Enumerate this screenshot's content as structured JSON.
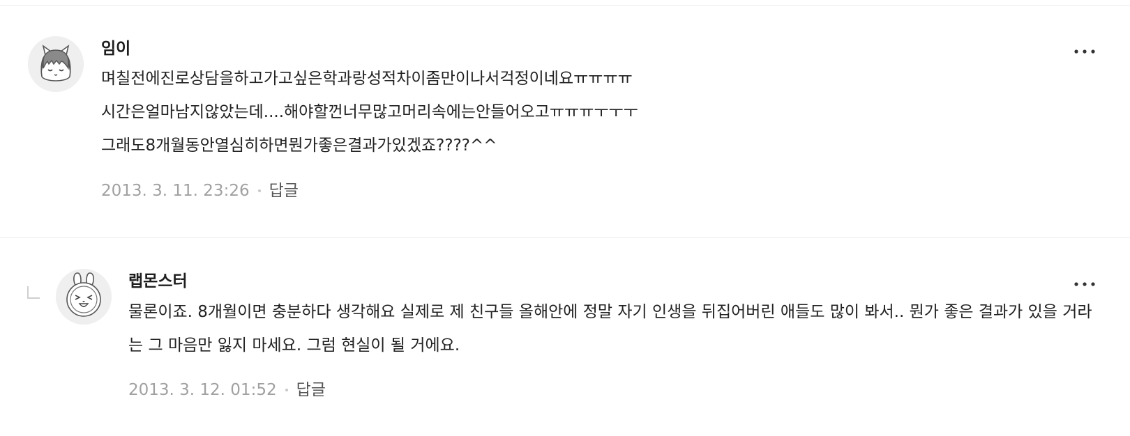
{
  "comments": [
    {
      "author": "임이",
      "avatar_icon": "sleepy-cat-avatar-icon",
      "lines": [
        "며칠전에진로상담을하고가고싶은학과랑성적차이좀만이나서걱정이네요ㅠㅠㅠㅠ",
        "시간은얼마남지않았는데....해야할껀너무많고머리속에는안들어오고ㅠㅠㅠㅜㅜㅜ",
        "그래도8개월동안열심히하면뭔가좋은결과가있겠죠????^^"
      ],
      "timestamp": "2013. 3. 11. 23:26",
      "reply_label": "답글",
      "more_icon": "more-options-icon"
    },
    {
      "author": "랩몬스터",
      "avatar_icon": "laughing-bunny-avatar-icon",
      "is_reply": true,
      "reply_indicator_icon": "reply-arrow-icon",
      "body": "물론이죠. 8개월이면 충분하다 생각해요 실제로 제 친구들 올해안에 정말 자기 인생을 뒤집어버린 애들도 많이 봐서.. 뭔가 좋은 결과가 있을 거라는 그 마음만 잃지 마세요. 그럼 현실이 될 거에요.",
      "timestamp": "2013. 3. 12. 01:52",
      "reply_label": "답글",
      "more_icon": "more-options-icon"
    }
  ]
}
